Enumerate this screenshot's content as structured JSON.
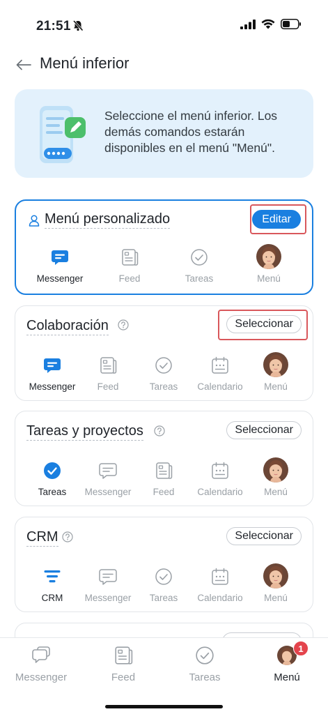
{
  "status_bar": {
    "time": "21:51"
  },
  "header": {
    "title": "Menú inferior"
  },
  "info": {
    "text": "Seleccione el menú inferior. Los demás comandos estarán disponibles en el menú \"Menú\"."
  },
  "presets": [
    {
      "title": "Menú personalizado",
      "action": "Editar",
      "selected": true,
      "items": [
        {
          "label": "Messenger",
          "icon": "messenger-icon",
          "active": true
        },
        {
          "label": "Feed",
          "icon": "feed-icon"
        },
        {
          "label": "Tareas",
          "icon": "tasks-icon"
        },
        {
          "label": "Menú",
          "icon": "avatar"
        }
      ]
    },
    {
      "title": "Colaboración",
      "action": "Seleccionar",
      "items": [
        {
          "label": "Messenger",
          "icon": "messenger-icon",
          "active": true
        },
        {
          "label": "Feed",
          "icon": "feed-icon"
        },
        {
          "label": "Tareas",
          "icon": "tasks-icon"
        },
        {
          "label": "Calendario",
          "icon": "calendar-icon"
        },
        {
          "label": "Menú",
          "icon": "avatar"
        }
      ]
    },
    {
      "title": "Tareas y proyectos",
      "action": "Seleccionar",
      "items": [
        {
          "label": "Tareas",
          "icon": "tasks-icon",
          "active": true
        },
        {
          "label": "Messenger",
          "icon": "messenger-icon"
        },
        {
          "label": "Feed",
          "icon": "feed-icon"
        },
        {
          "label": "Calendario",
          "icon": "calendar-icon"
        },
        {
          "label": "Menú",
          "icon": "avatar"
        }
      ]
    },
    {
      "title": "CRM",
      "action": "Seleccionar",
      "items": [
        {
          "label": "CRM",
          "icon": "crm-funnel-icon",
          "active": true
        },
        {
          "label": "Messenger",
          "icon": "messenger-icon"
        },
        {
          "label": "Tareas",
          "icon": "tasks-icon"
        },
        {
          "label": "Calendario",
          "icon": "calendar-icon"
        },
        {
          "label": "Menú",
          "icon": "avatar"
        }
      ]
    },
    {
      "title": "",
      "action": "",
      "items": []
    }
  ],
  "tabbar": {
    "items": [
      {
        "label": "Messenger",
        "icon": "messenger-icon"
      },
      {
        "label": "Feed",
        "icon": "feed-icon"
      },
      {
        "label": "Tareas",
        "icon": "tasks-icon"
      },
      {
        "label": "Menú",
        "icon": "avatar",
        "active": true,
        "badge": "1"
      }
    ]
  },
  "colors": {
    "accent": "#1a7fe0",
    "highlight": "#d9575b",
    "badge": "#e4444c",
    "banner": "#e3f1fc"
  }
}
